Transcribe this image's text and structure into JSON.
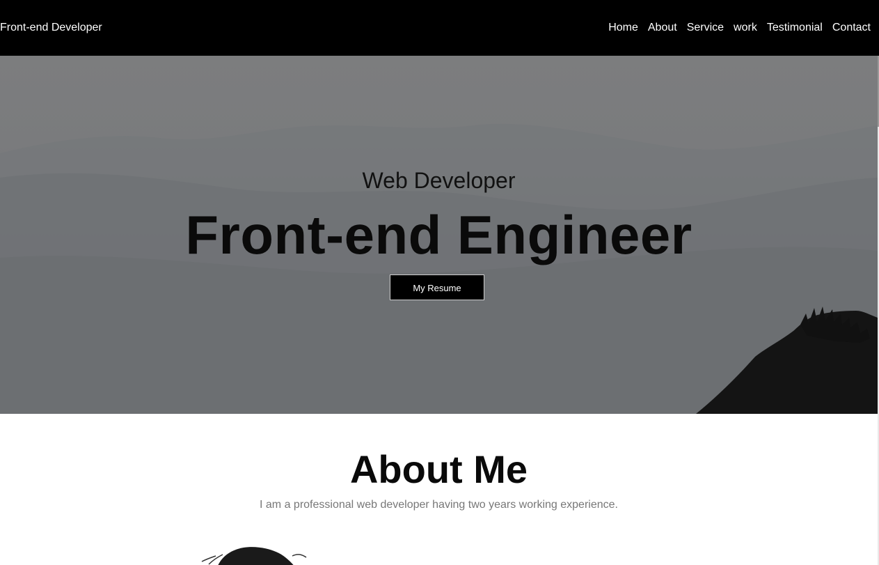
{
  "navbar": {
    "brand": "Front-end Developer",
    "links": [
      "Home",
      "About",
      "Service",
      "work",
      "Testimonial",
      "Contact"
    ]
  },
  "hero": {
    "subtitle": "Web Developer",
    "title": "Front-end Engineer",
    "button_label": "My Resume"
  },
  "about": {
    "title": "About Me",
    "text": "I am a professional web developer having two years working experience."
  },
  "colors": {
    "navbar_bg": "#000000",
    "hero_overlay": "#7a7b7d",
    "button_bg": "#000000",
    "body_text": "#777777"
  },
  "icons": [
    "avatar-photo",
    "mountain-background"
  ]
}
